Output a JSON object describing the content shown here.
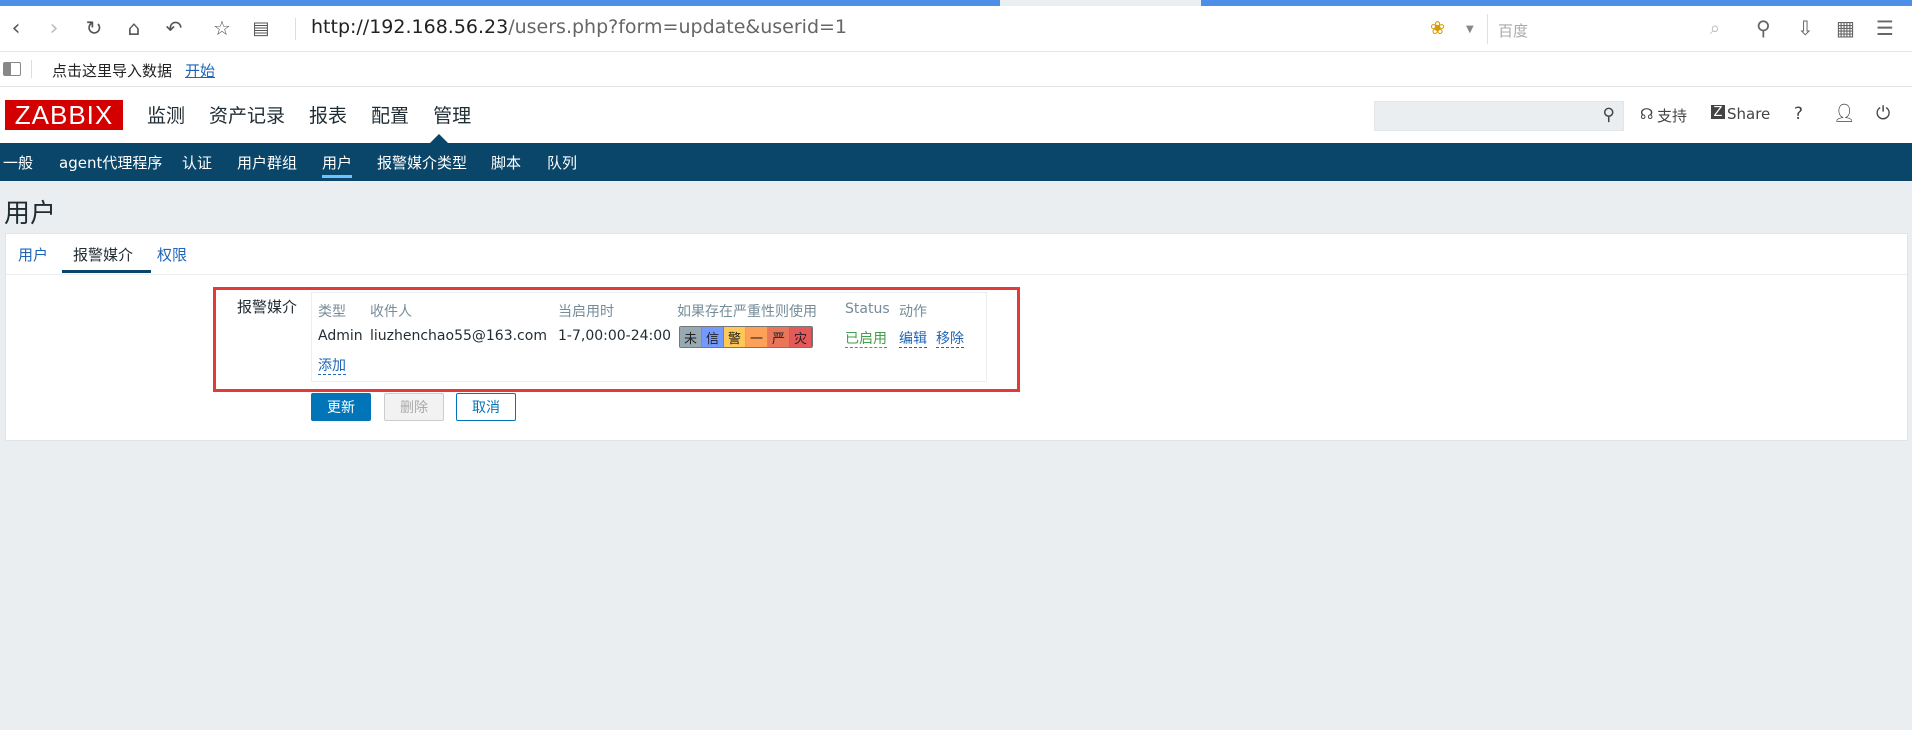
{
  "browser": {
    "url_host": "http://192.168.56.23",
    "url_rest": "/users.php?form=update&userid=1",
    "search_placeholder": "百度",
    "bookmark_text": "点击这里导入数据",
    "bookmark_link": "开始"
  },
  "header": {
    "logo": "ZABBIX",
    "menu": [
      "监测",
      "资产记录",
      "报表",
      "配置",
      "管理"
    ],
    "support": "支持",
    "share": "Share",
    "help": "?"
  },
  "submenu": [
    "一般",
    "agent代理程序",
    "认证",
    "用户群组",
    "用户",
    "报警媒介类型",
    "脚本",
    "队列"
  ],
  "page": {
    "title": "用户",
    "tabs": [
      "用户",
      "报警媒介",
      "权限"
    ],
    "field_label": "报警媒介"
  },
  "media_table": {
    "headers": [
      "类型",
      "收件人",
      "当启用时",
      "如果存在严重性则使用",
      "Status",
      "动作"
    ],
    "row": {
      "type": "Admin",
      "recipient": "liuzhenchao55@163.com",
      "when_active": "1-7,00:00-24:00",
      "severities": [
        {
          "label": "未",
          "color": "#97aab3"
        },
        {
          "label": "信",
          "color": "#7499ff"
        },
        {
          "label": "警",
          "color": "#ffc859"
        },
        {
          "label": "一",
          "color": "#ffa059"
        },
        {
          "label": "严",
          "color": "#e97659"
        },
        {
          "label": "灾",
          "color": "#e45959"
        }
      ],
      "status": "已启用",
      "edit": "编辑",
      "remove": "移除"
    },
    "add": "添加"
  },
  "buttons": {
    "update": "更新",
    "delete": "删除",
    "cancel": "取消"
  },
  "colors": {
    "brand": "#d40000",
    "submenu_bg": "#0a466a",
    "primary": "#0275b8",
    "highlight_box": "#e03a3a"
  }
}
